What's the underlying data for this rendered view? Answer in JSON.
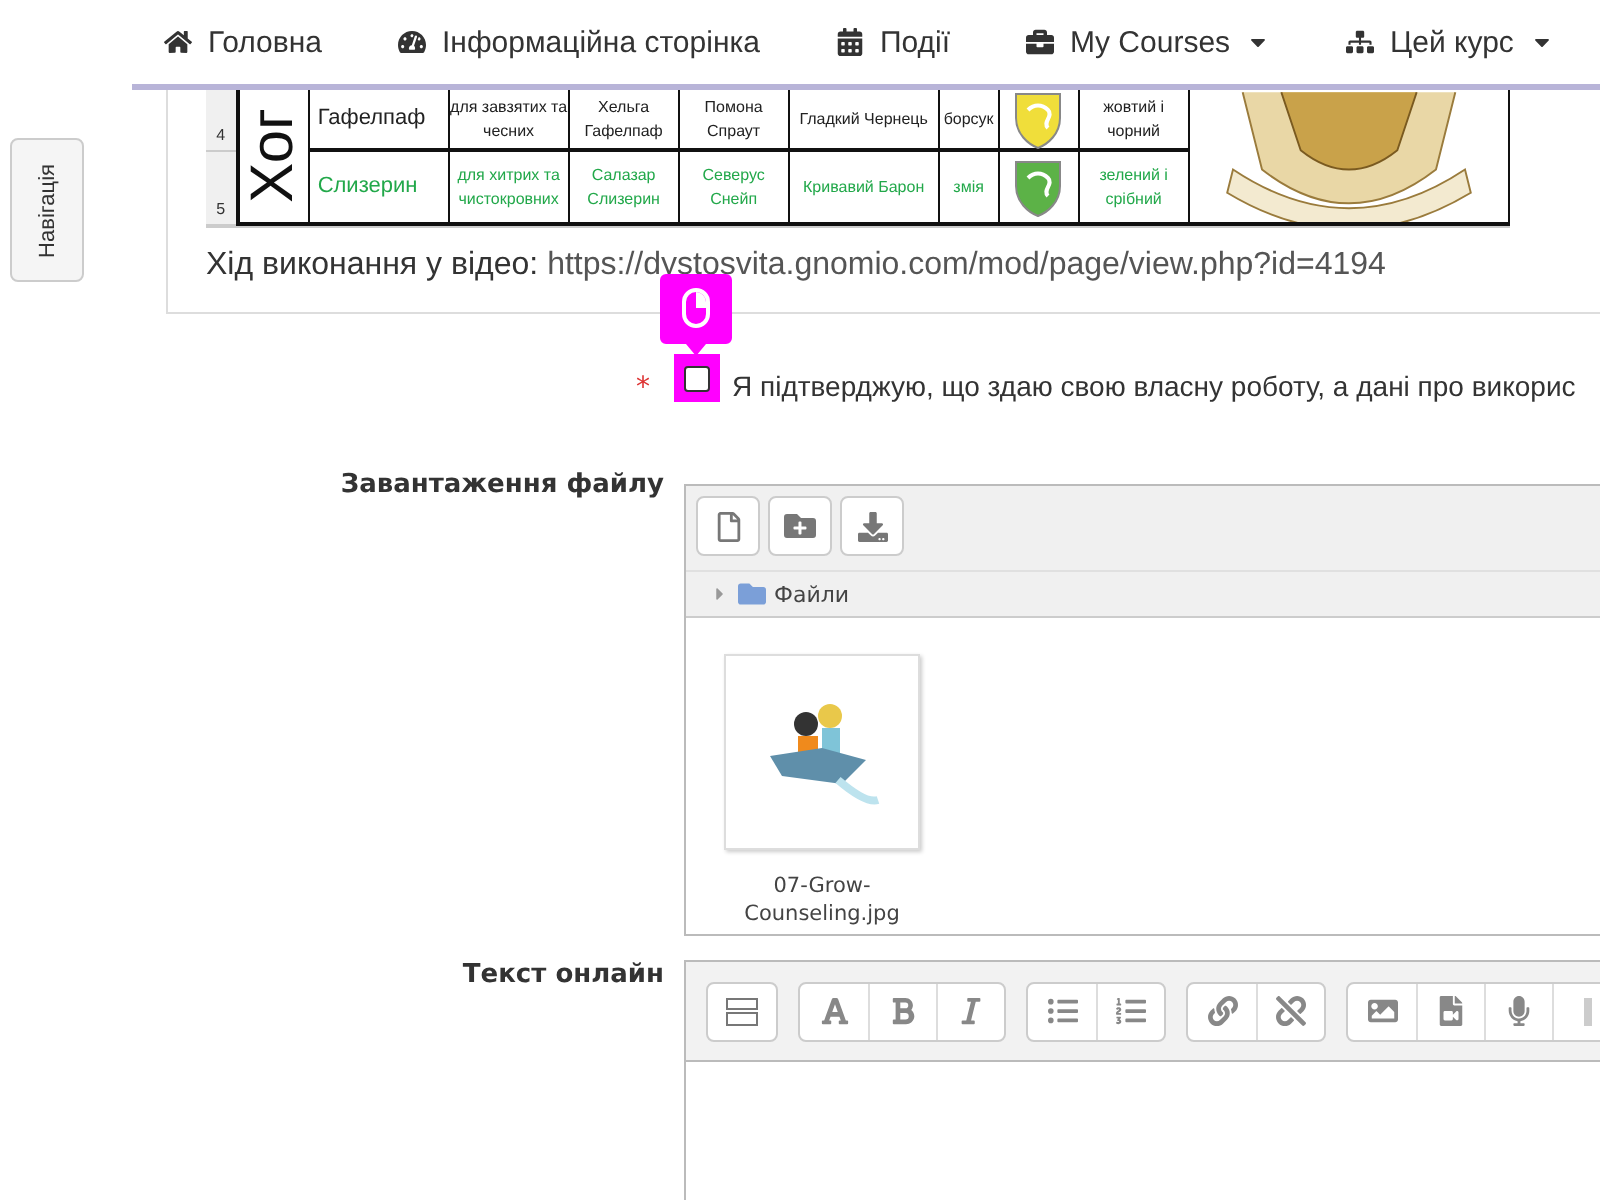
{
  "nav": {
    "items": [
      {
        "label": "Головна",
        "dropdown": false
      },
      {
        "label": "Інформаційна сторінка",
        "dropdown": false
      },
      {
        "label": "Події",
        "dropdown": false
      },
      {
        "label": "My Courses",
        "dropdown": true
      },
      {
        "label": "Цей курс",
        "dropdown": true
      }
    ]
  },
  "drawer_toggle": {
    "label": "Навігація"
  },
  "spreadsheet": {
    "side_label": "Хог",
    "rows": [
      {
        "row_number": "4",
        "color": "#222222",
        "cells": [
          "Гафелпаф",
          "для завзятих та чесних",
          "Хельга Гафелпаф",
          "Помона Спраут",
          "Гладкий Чернець",
          "борсук",
          "жовтий і чорний"
        ]
      },
      {
        "row_number": "5",
        "color": "#22a84a",
        "cells": [
          "Слизерин",
          "для хитрих та чистокровних",
          "Салазар Слизерин",
          "Северус Снейп",
          "Кривавий Барон",
          "змія",
          "зелений і срібний"
        ]
      }
    ]
  },
  "video_line": {
    "label": "Хід виконання у відео:",
    "url": "https://dystosvita.gnomio.com/mod/page/view.php?id=4194"
  },
  "confirmation": {
    "required_mark": "*",
    "checked": false,
    "text": "Я підтверджую, що здаю свою власну роботу, а дані про викорис"
  },
  "file_upload": {
    "label": "Завантаження файлу",
    "path": "Файли",
    "files": [
      {
        "name": "07-Grow-Counseling.jpg"
      }
    ]
  },
  "online_text": {
    "label": "Текст онлайн"
  }
}
